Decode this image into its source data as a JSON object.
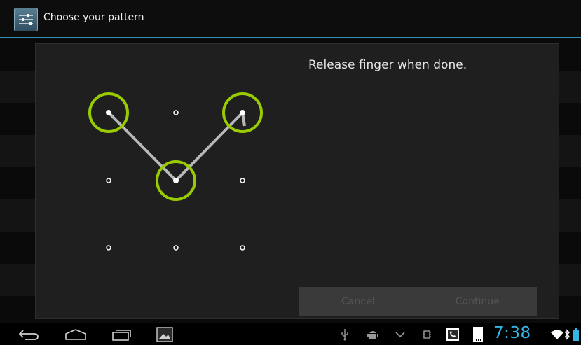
{
  "header": {
    "title": "Choose your pattern",
    "icon": "settings-sliders-icon"
  },
  "instruction": "Release finger when done.",
  "pattern": {
    "grid_rows": 3,
    "grid_cols": 3,
    "selected_sequence": [
      1,
      5,
      3
    ],
    "accent_color": "#99cc00"
  },
  "buttons": {
    "cancel_label": "Cancel",
    "continue_label": "Continue"
  },
  "navbar": {
    "back_icon": "back-icon",
    "home_icon": "home-icon",
    "recents_icon": "recent-apps-icon",
    "screenshot_icon": "screenshot-icon"
  },
  "status": {
    "time": "7:38",
    "icons": [
      "usb-icon",
      "android-debug-icon",
      "download-icon",
      "chip-icon",
      "phone-icon",
      "sd-card-icon",
      "wifi-icon",
      "bluetooth-icon",
      "battery-icon"
    ],
    "time_color": "#33b5e5"
  }
}
